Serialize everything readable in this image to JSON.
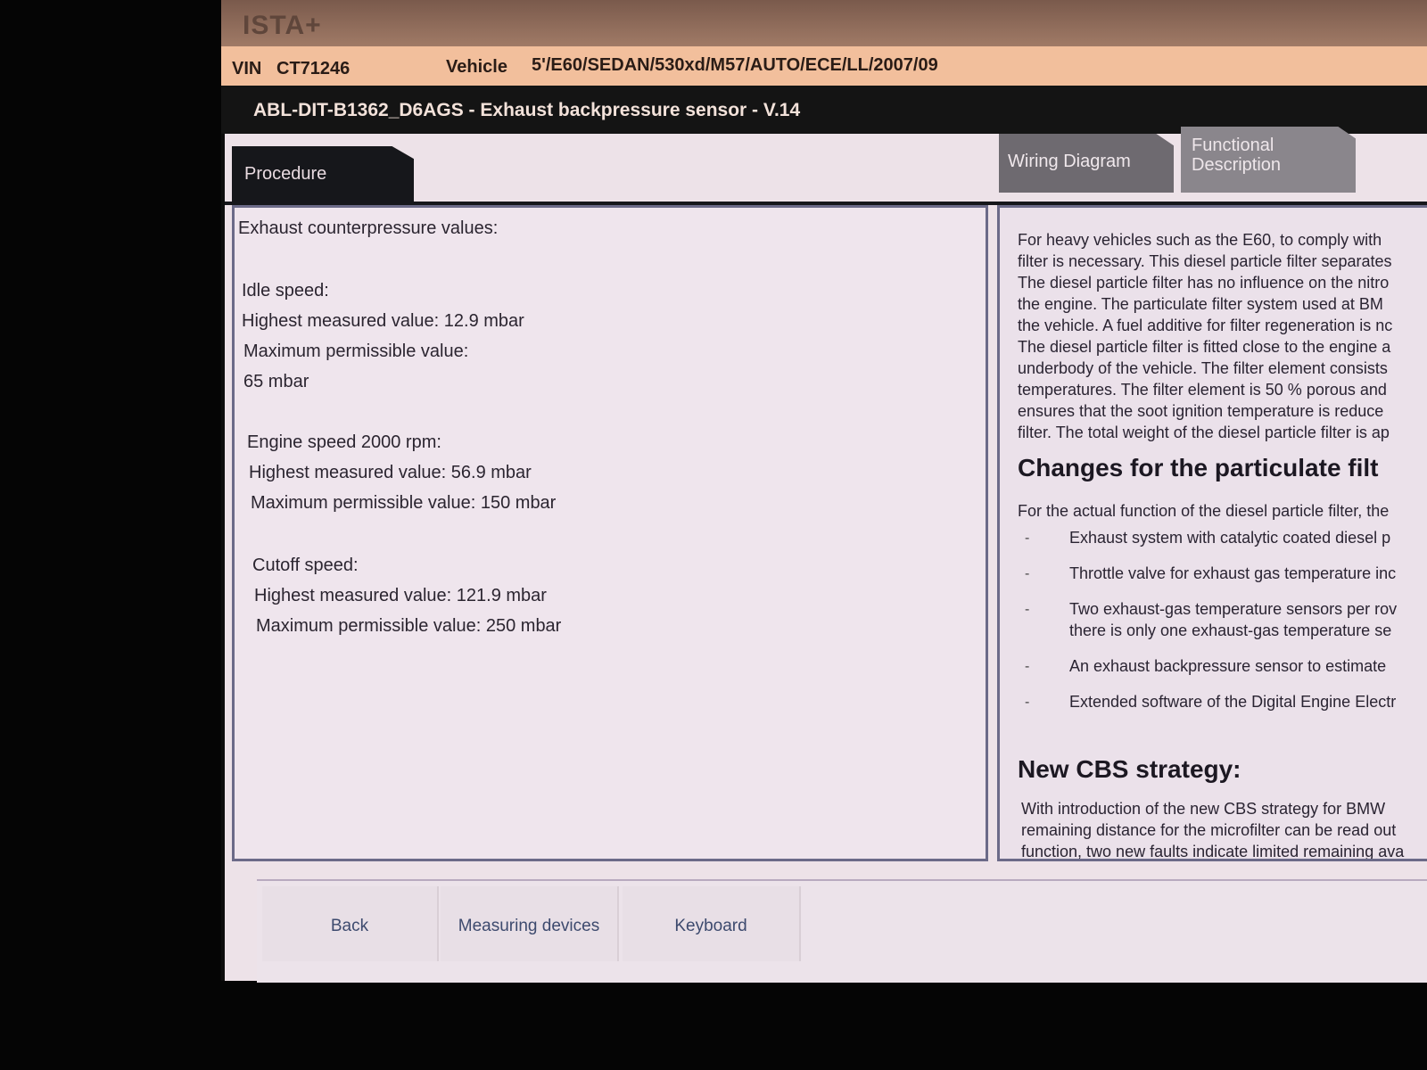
{
  "app": {
    "logo": "ISTA+"
  },
  "vehicle_bar": {
    "vin_label": "VIN",
    "vin_value": "CT71246",
    "vehicle_label": "Vehicle",
    "vehicle_value": "5'/E60/SEDAN/530xd/M57/AUTO/ECE/LL/2007/09"
  },
  "document": {
    "title": "ABL-DIT-B1362_D6AGS - Exhaust backpressure sensor - V.14"
  },
  "tabs": {
    "procedure": "Procedure",
    "wiring_diagram": "Wiring Diagram",
    "functional_line1": "Functional",
    "functional_line2": "Description"
  },
  "procedure": {
    "heading": "Exhaust counterpressure values:",
    "idle_label": "Idle speed:",
    "idle_highest": "Highest measured value: 12.9 mbar",
    "idle_max_label": "Maximum permissible value:",
    "idle_max_value": "65 mbar",
    "rpm2000_label": "Engine speed 2000 rpm:",
    "rpm2000_highest": "Highest measured value: 56.9 mbar",
    "rpm2000_max": "Maximum permissible value: 150 mbar",
    "cutoff_label": "Cutoff speed:",
    "cutoff_highest": "Highest measured value: 121.9 mbar",
    "cutoff_max": "Maximum permissible value: 250 mbar"
  },
  "functional": {
    "intro": [
      "For heavy vehicles such as the E60, to comply with",
      "filter is necessary. This diesel particle filter separates",
      "The diesel particle filter has no influence on the nitro",
      "the engine. The particulate filter system used at BM",
      "the vehicle. A fuel additive for filter regeneration is nc",
      "The diesel particle filter is fitted close to the engine a",
      "underbody of the vehicle. The filter element consists",
      "temperatures. The filter element is 50 % porous and",
      "ensures that the soot ignition temperature is reduce",
      "filter. The total weight of the diesel particle filter is ap"
    ],
    "heading_changes": "Changes for the particulate filt",
    "changes_intro": "For the actual function of the diesel particle filter, the",
    "bullets": [
      "Exhaust system with catalytic coated diesel p",
      "Throttle valve for exhaust gas temperature inc",
      "Two exhaust-gas temperature sensors per rov",
      "there is only one exhaust-gas temperature se",
      "An exhaust backpressure sensor to estimate",
      "Extended software of the Digital Engine Electr"
    ],
    "heading_cbs": "New CBS strategy:",
    "cbs_text": [
      "With introduction of the new CBS strategy for BMW",
      "remaining distance for the microfilter can be read out",
      "function, two new faults indicate limited remaining ava"
    ]
  },
  "buttons": {
    "back": "Back",
    "measuring_devices": "Measuring devices",
    "keyboard": "Keyboard"
  }
}
